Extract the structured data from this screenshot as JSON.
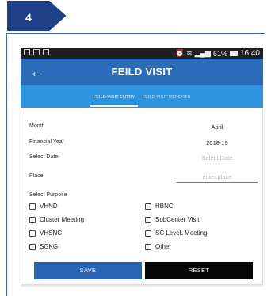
{
  "step": {
    "number": "4"
  },
  "statusbar": {
    "battery": "61%",
    "time": "16:40"
  },
  "appbar": {
    "back_icon": "←",
    "title": "FEILD VISIT"
  },
  "tabs": [
    {
      "label": "FEILD VISIT ENTRY",
      "selected": true
    },
    {
      "label": "FEILD VISIT REPORTS",
      "selected": false
    }
  ],
  "form": {
    "month": {
      "label": "Month",
      "value": "April"
    },
    "financial_year": {
      "label": "Financial Year",
      "value": "2018-19"
    },
    "select_date": {
      "label": "Select Date",
      "placeholder": "Select Date"
    },
    "place": {
      "label": "Place",
      "placeholder": "enter place"
    },
    "purpose_label": "Select Purpose",
    "purposes": [
      {
        "label": "VHND",
        "checked": false
      },
      {
        "label": "HBNC",
        "checked": false
      },
      {
        "label": "Cluster Meeting",
        "checked": false
      },
      {
        "label": "SubCenter Visit",
        "checked": false
      },
      {
        "label": "VHSNC",
        "checked": false
      },
      {
        "label": "SC LeveL Meeting",
        "checked": false
      },
      {
        "label": "SGKG",
        "checked": false
      },
      {
        "label": "Other",
        "checked": false
      }
    ]
  },
  "buttons": {
    "save": "SAVE",
    "reset": "RESET"
  },
  "colors": {
    "appbar": "#2a6cb9",
    "tabs": "#2f94e0",
    "save": "#2a63b0",
    "reset": "#050505",
    "step_tag": "#1f3f88"
  }
}
